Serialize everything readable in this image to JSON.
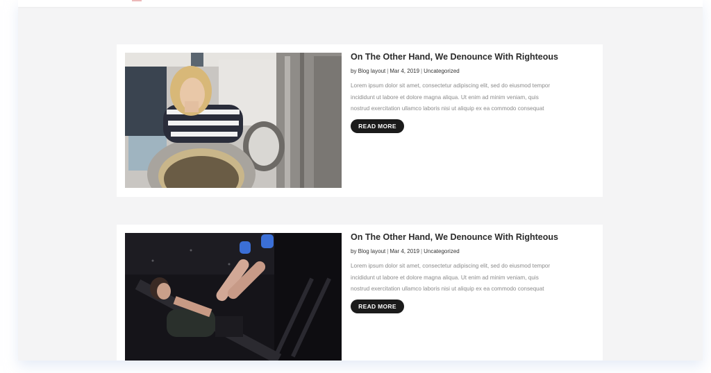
{
  "posts": [
    {
      "title": "On The Other Hand, We Denounce With Righteous",
      "meta": {
        "author": "by Blog layout",
        "date": "Mar 4, 2019",
        "category": "Uncategorized"
      },
      "excerpt": [
        "Lorem ipsum dolor sit amet, consectetur adipiscing elit, sed do eiusmod tempor",
        "incididunt ut labore et dolore magna aliqua. Ut enim ad minim veniam, quis",
        "nostrud exercitation ullamco laboris nisi ut aliquip ex ea commodo consequat"
      ],
      "read_more": "READ MORE",
      "image": "laundromat-photo"
    },
    {
      "title": "On The Other Hand, We Denounce With Righteous",
      "meta": {
        "author": "by Blog layout",
        "date": "Mar 4, 2019",
        "category": "Uncategorized"
      },
      "excerpt": [
        "Lorem ipsum dolor sit amet, consectetur adipiscing elit, sed do eiusmod tempor",
        "incididunt ut labore et dolore magna aliqua. Ut enim ad minim veniam, quis",
        "nostrud exercitation ullamco laboris nisi ut aliquip ex ea commodo consequat"
      ],
      "read_more": "READ MORE",
      "image": "gym-leg-press-photo"
    }
  ],
  "colors": {
    "page_background": "#f4f4f5",
    "card_background": "#ffffff",
    "button_background": "#1b1b1b",
    "title_text": "#2b2b2b",
    "excerpt_text": "#8a8a8a"
  }
}
